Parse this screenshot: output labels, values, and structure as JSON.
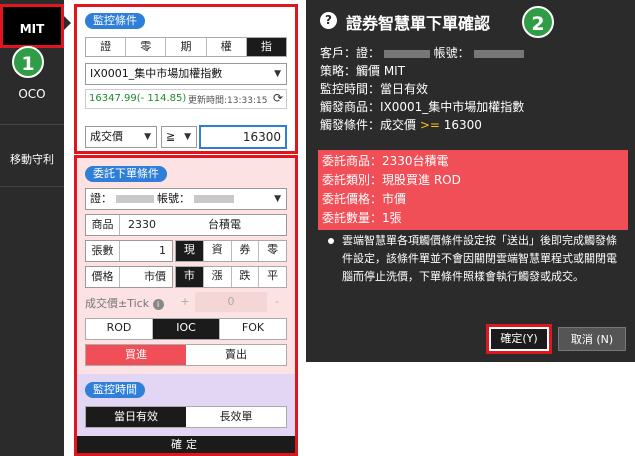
{
  "nav": {
    "mit": "MIT",
    "oco": "OCO",
    "trail": "移動守利"
  },
  "badges": {
    "b1": "1",
    "b2": "2"
  },
  "monitor": {
    "header": "監控條件",
    "tabs": [
      "證",
      "零",
      "期",
      "權",
      "指"
    ],
    "active_tab": 4,
    "product": "IX0001_集中市場加權指數",
    "quote": "16347.99(- 114.85)",
    "update_label": "更新時間:13:33:15",
    "price_field": "成交價",
    "operator": "≧",
    "trigger_value": "16300"
  },
  "order": {
    "header": "委託下單條件",
    "account_prefix": "證：",
    "account_label": "帳號：",
    "product_label": "商品",
    "product_code": "2330",
    "product_name": "台積電",
    "qty_label": "張數",
    "qty_value": "1",
    "qty_tabs": [
      "現",
      "資",
      "券",
      "零"
    ],
    "price_label": "價格",
    "price_value": "市價",
    "price_tabs": [
      "市",
      "漲",
      "跌",
      "平"
    ],
    "tick_label": "成交價±Tick",
    "tick_plus": "+",
    "tick_value": "0",
    "tick_minus": "-",
    "tif_tabs": [
      "ROD",
      "IOC",
      "FOK"
    ],
    "side_buy": "買進",
    "side_sell": "賣出"
  },
  "time": {
    "header": "監控時間",
    "tabs": [
      "當日有效",
      "長效單"
    ]
  },
  "confirm_bar": "確定",
  "dialog": {
    "title": "證券智慧單下單確認",
    "customer_label": "客戶：證：",
    "account_label": "帳號：",
    "strategy": "策略：觸價 MIT",
    "monitor_time": "監控時間：當日有效",
    "trigger_product": "觸發商品：IX0001_集中市場加權指數",
    "trigger_cond_prefix": "觸發條件：成交價 ",
    "trigger_cond_op": ">=",
    "trigger_cond_value": " 16300",
    "order_product": "委託商品：2330台積電",
    "order_type": "委託類別：現股買進 ROD",
    "order_price": "委託價格：市價",
    "order_qty": "委託數量：1張",
    "note": "雲端智慧單各項觸價條件設定按「送出」後即完成觸發條件設定，該條件單並不會因關閉雲端智慧單程式或關閉電腦而停止洗價，下單條件照樣會執行觸發或成交。",
    "ok": "確定(Y)",
    "cancel": "取消 (N)"
  }
}
